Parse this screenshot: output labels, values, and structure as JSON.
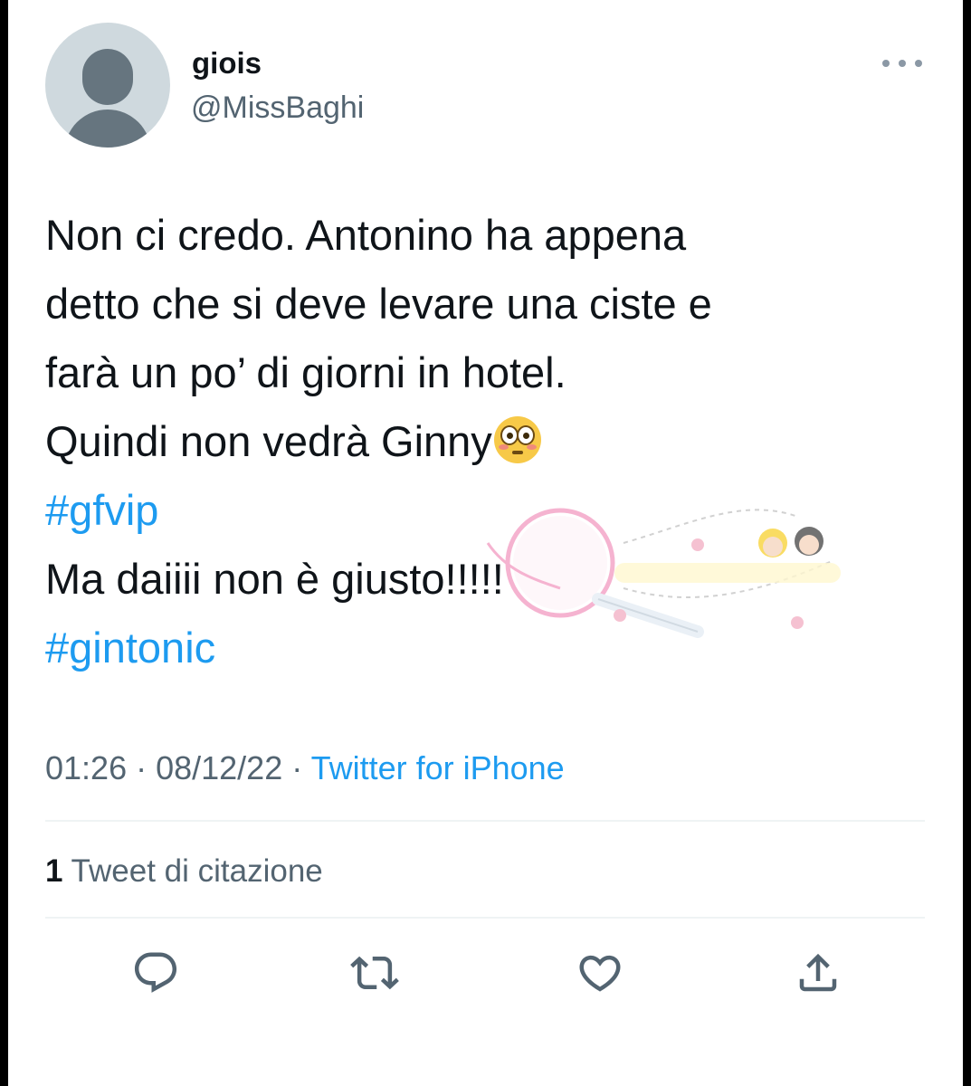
{
  "user": {
    "display_name": "giois",
    "handle": "@MissBaghi"
  },
  "tweet": {
    "line1": "Non ci credo. Antonino ha appena",
    "line2": "detto che si deve levare una ciste e",
    "line3": "farà un po’ di giorni in hotel.",
    "line4": "Quindi non vedrà Ginny",
    "emoji": "flushed-face",
    "hashtag1": "#gfvip",
    "line6": "Ma daiiii non è giusto!!!!!",
    "hashtag2": "#gintonic"
  },
  "meta": {
    "time": "01:26",
    "separator1": " · ",
    "date": "08/12/22",
    "separator2": " · ",
    "source": "Twitter for iPhone"
  },
  "stats": {
    "quote_count": "1",
    "quote_label": " Tweet di citazione"
  },
  "actions": {
    "reply_icon": "reply-icon",
    "retweet_icon": "retweet-icon",
    "like_icon": "like-icon",
    "share_icon": "share-icon"
  },
  "colors": {
    "accent": "#1d9bf0",
    "text_primary": "#0f1419",
    "text_secondary": "#536471",
    "divider": "#eff3f4",
    "avatar_bg": "#cfd9de",
    "avatar_fg": "#66757f"
  }
}
